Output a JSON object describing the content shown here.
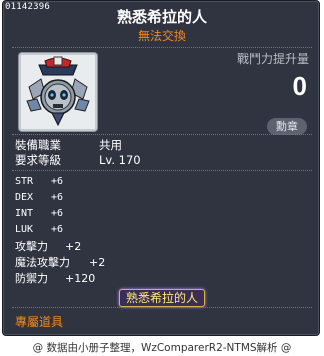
{
  "item_id": "01142396",
  "title": "熟悉希拉的人",
  "subtitle": "無法交換",
  "power": {
    "label": "戰鬥力提升量",
    "value": "0"
  },
  "badge_button": "勳章",
  "info": [
    {
      "key": "裝備職業",
      "value": "共用"
    },
    {
      "key": "要求等級",
      "value": "Lv. 170"
    }
  ],
  "stats": [
    {
      "key": "STR",
      "value": "+6"
    },
    {
      "key": "DEX",
      "value": "+6"
    },
    {
      "key": "INT",
      "value": "+6"
    },
    {
      "key": "LUK",
      "value": "+6"
    },
    {
      "key": "攻擊力",
      "value": "+2"
    },
    {
      "key": "魔法攻擊力",
      "value": "+2"
    },
    {
      "key": "防禦力",
      "value": "+120"
    }
  ],
  "set_tag": "熟悉希拉的人",
  "footer_label": "專屬道具",
  "credit": "@ 数据由小册子整理，WzComparerR2-NTMS解析 @",
  "colors": {
    "background": "#2f3440",
    "accent_orange": "#f08a1c",
    "tag_gold": "#ffe97a"
  },
  "icon": "medal-skull-emblem-icon"
}
